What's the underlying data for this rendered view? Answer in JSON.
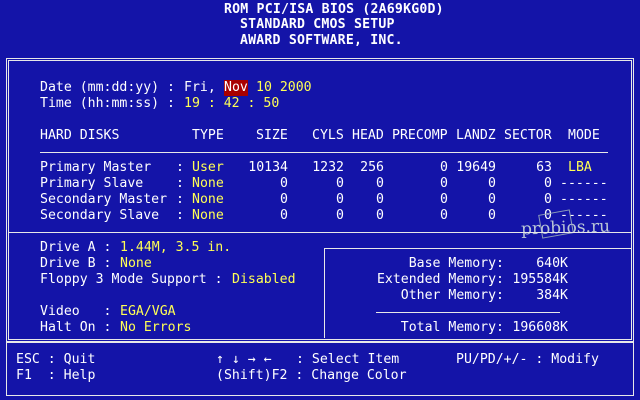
{
  "header": {
    "line1": "ROM PCI/ISA BIOS (2A69KG0D)",
    "line2": "STANDARD CMOS SETUP",
    "line3": "AWARD SOFTWARE, INC."
  },
  "datetime": {
    "date_label": "Date (mm:dd:yy) :",
    "date_day": "Fri,",
    "date_month": "Nov",
    "date_rest": "10 2000",
    "time_label": "Time (hh:mm:ss) :",
    "time_value": "19 : 42 : 50"
  },
  "disks": {
    "columns": [
      "HARD DISKS",
      "TYPE",
      "SIZE",
      "CYLS",
      "HEAD",
      "PRECOMP",
      "LANDZ",
      "SECTOR",
      "MODE"
    ],
    "rows": [
      {
        "name": "Primary Master",
        "type": "User",
        "size": "10134",
        "cyls": "1232",
        "head": "256",
        "precomp": "0",
        "landz": "19649",
        "sector": "63",
        "mode": "LBA"
      },
      {
        "name": "Primary Slave",
        "type": "None",
        "size": "0",
        "cyls": "0",
        "head": "0",
        "precomp": "0",
        "landz": "0",
        "sector": "0",
        "mode": "------"
      },
      {
        "name": "Secondary Master",
        "type": "None",
        "size": "0",
        "cyls": "0",
        "head": "0",
        "precomp": "0",
        "landz": "0",
        "sector": "0",
        "mode": "------"
      },
      {
        "name": "Secondary Slave",
        "type": "None",
        "size": "0",
        "cyls": "0",
        "head": "0",
        "precomp": "0",
        "landz": "0",
        "sector": "0",
        "mode": "------"
      }
    ]
  },
  "drives": {
    "drive_a_label": "Drive A :",
    "drive_a_value": "1.44M, 3.5 in.",
    "drive_b_label": "Drive B :",
    "drive_b_value": "None",
    "floppy_label": "Floppy 3 Mode Support :",
    "floppy_value": "Disabled"
  },
  "misc": {
    "video_label": "Video   :",
    "video_value": "EGA/VGA",
    "halt_label": "Halt On :",
    "halt_value": "No Errors"
  },
  "memory": {
    "base_label": "Base Memory:",
    "base_value": "640K",
    "extended_label": "Extended Memory:",
    "extended_value": "195584K",
    "other_label": "Other Memory:",
    "other_value": "384K",
    "total_label": "Total Memory:",
    "total_value": "196608K"
  },
  "footer": {
    "esc": "ESC : Quit",
    "f1": "F1  : Help",
    "arrows": "↑ ↓ → ←",
    "select": ": Select Item",
    "shift": "(Shift)F2 : Change Color",
    "modify": "PU/PD/+/- : Modify"
  },
  "watermark": "probios.ru"
}
